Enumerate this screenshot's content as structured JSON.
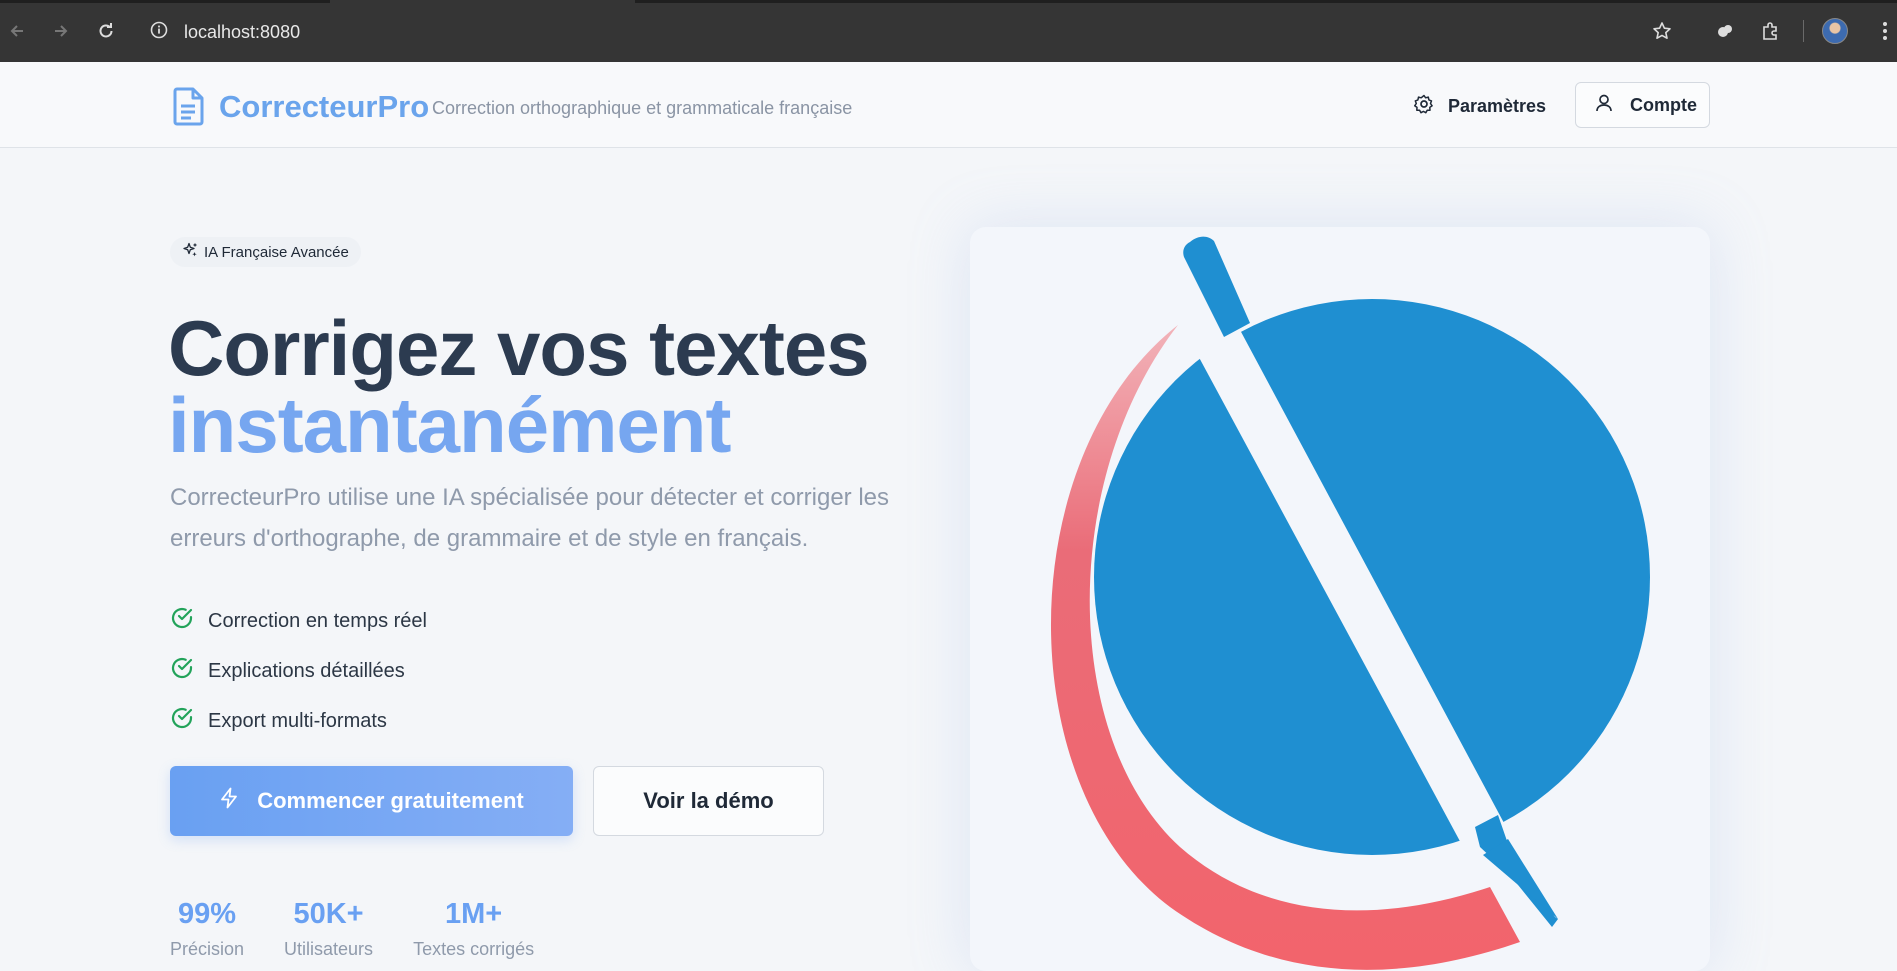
{
  "browser": {
    "url": "localhost:8080"
  },
  "header": {
    "brand": "CorrecteurPro",
    "tagline": "Correction orthographique et grammaticale française",
    "settings_label": "Paramètres",
    "account_label": "Compte"
  },
  "hero": {
    "badge": "IA Française Avancée",
    "headline_line1": "Corrigez vos textes",
    "headline_line2": "instantanément",
    "lead": "CorrecteurPro utilise une IA spécialisée pour détecter et corriger les erreurs d'orthographe, de grammaire et de style en français.",
    "features": [
      {
        "label": "Correction en temps réel"
      },
      {
        "label": "Explications détaillées"
      },
      {
        "label": "Export multi-formats"
      }
    ],
    "cta_primary": "Commencer gratuitement",
    "cta_secondary": "Voir la démo",
    "stats": [
      {
        "value": "99%",
        "label": "Précision"
      },
      {
        "value": "50K+",
        "label": "Utilisateurs"
      },
      {
        "value": "1M+",
        "label": "Textes corrigés"
      }
    ]
  },
  "colors": {
    "accent": "#6aa4ec",
    "globe": "#1f8fd1",
    "arc": "#ee6b74",
    "check": "#22a35a",
    "headline": "#2c3b50"
  },
  "icons": {
    "logo": "document-icon",
    "settings": "gear-icon",
    "account": "user-icon",
    "badge": "sparkles-icon",
    "feature": "check-circle-icon",
    "cta": "lightning-icon"
  }
}
